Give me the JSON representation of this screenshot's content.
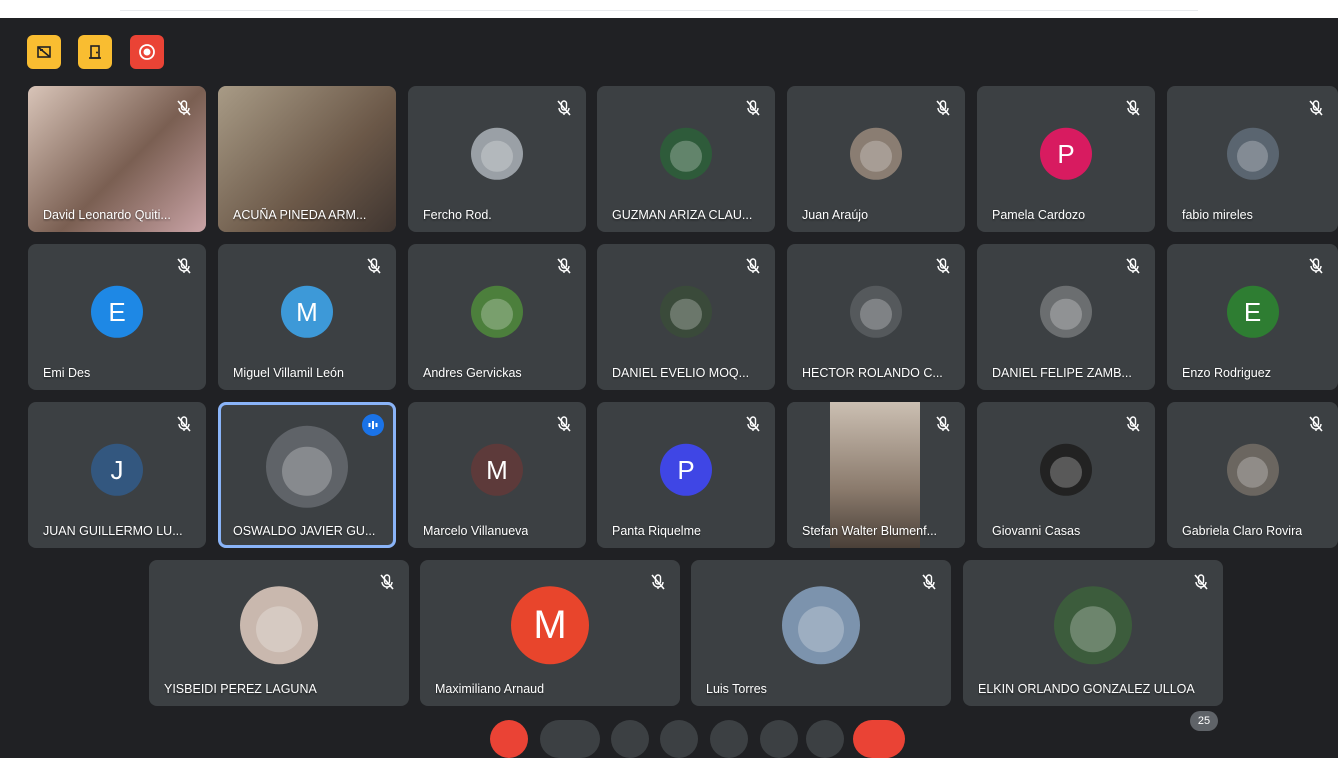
{
  "colors": {
    "background": "#202124",
    "tile": "#3c4043",
    "speaking_outline": "#8ab4f8",
    "control_yellow": "#f9bd31",
    "control_red": "#ea4335"
  },
  "controls": [
    {
      "name": "hide-video-icon",
      "color": "yellow"
    },
    {
      "name": "door-icon",
      "color": "yellow"
    },
    {
      "name": "record-icon",
      "color": "red"
    }
  ],
  "participants": [
    {
      "name": "David Leonardo Quiti...",
      "type": "video",
      "muted": true
    },
    {
      "name": "ACUÑA PINEDA ARM...",
      "type": "video",
      "muted": false
    },
    {
      "name": "Fercho Rod.",
      "type": "photo",
      "color": "#9aa0a6",
      "muted": true
    },
    {
      "name": "GUZMAN ARIZA CLAU...",
      "type": "photo",
      "color": "#2e5b3a",
      "muted": true
    },
    {
      "name": "Juan Araújo",
      "type": "photo",
      "color": "#8a7d72",
      "muted": true
    },
    {
      "name": "Pamela Cardozo",
      "type": "letter",
      "letter": "P",
      "color": "#d81b60",
      "muted": true
    },
    {
      "name": "fabio mireles",
      "type": "photo",
      "color": "#5a6570",
      "muted": true
    },
    {
      "name": "Emi Des",
      "type": "letter",
      "letter": "E",
      "color": "#1e88e5",
      "muted": true
    },
    {
      "name": "Miguel Villamil León",
      "type": "letter",
      "letter": "M",
      "color": "#3d99d8",
      "muted": true
    },
    {
      "name": "Andres Gervickas",
      "type": "photo",
      "color": "#4c7f3c",
      "muted": true
    },
    {
      "name": "DANIEL EVELIO MOQ...",
      "type": "photo",
      "color": "#3a4a3a",
      "muted": true
    },
    {
      "name": "HECTOR ROLANDO C...",
      "type": "photo",
      "color": "#55595c",
      "muted": true
    },
    {
      "name": "DANIEL FELIPE ZAMB...",
      "type": "photo",
      "color": "#6b6e70",
      "muted": true
    },
    {
      "name": "Enzo Rodriguez",
      "type": "letter",
      "letter": "E",
      "color": "#2e7d32",
      "muted": true
    },
    {
      "name": "JUAN GUILLERMO LU...",
      "type": "letter",
      "letter": "J",
      "color": "#33577f",
      "muted": true
    },
    {
      "name": "OSWALDO JAVIER GU...",
      "type": "photo",
      "color": "#6a6a6a",
      "muted": false,
      "speaking": true
    },
    {
      "name": "Marcelo Villanueva",
      "type": "letter",
      "letter": "M",
      "color": "#5d3a3a",
      "muted": true
    },
    {
      "name": "Panta Riquelme",
      "type": "letter",
      "letter": "P",
      "color": "#3f46e5",
      "muted": true
    },
    {
      "name": "Stefan Walter Blumenf...",
      "type": "video",
      "muted": true
    },
    {
      "name": "Giovanni Casas",
      "type": "photo",
      "color": "#222",
      "muted": true
    },
    {
      "name": "Gabriela Claro Rovira",
      "type": "photo",
      "color": "#6b6660",
      "muted": true
    },
    {
      "name": "YISBEIDI PEREZ LAGUNA",
      "type": "photo",
      "color": "#c9b8ae",
      "muted": true
    },
    {
      "name": "Maximiliano Arnaud",
      "type": "letter",
      "letter": "M",
      "color": "#e8452c",
      "muted": true
    },
    {
      "name": "Luis Torres",
      "type": "photo",
      "color": "#7c93ad",
      "muted": true
    },
    {
      "name": "ELKIN ORLANDO GONZALEZ ULLOA",
      "type": "photo",
      "color": "#3c5c3c",
      "muted": true
    }
  ],
  "participant_count": "25"
}
